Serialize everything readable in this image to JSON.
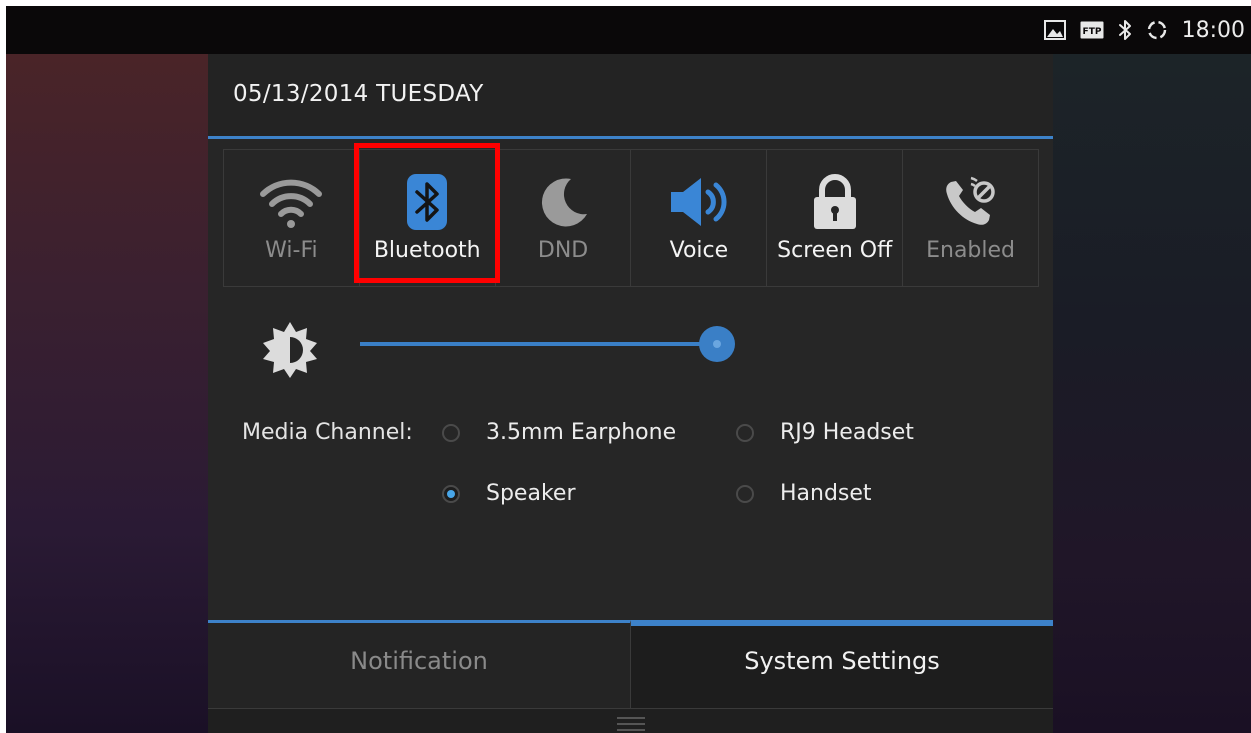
{
  "status_bar": {
    "icons": [
      "image-icon",
      "ftp-icon",
      "bluetooth-icon",
      "sync-icon"
    ],
    "ftp_label": "FTP",
    "time": "18:00"
  },
  "panel": {
    "date": "05/13/2014 TUESDAY",
    "toggles": [
      {
        "label": "Wi-Fi",
        "icon": "wifi-icon",
        "state": "off"
      },
      {
        "label": "Bluetooth",
        "icon": "bluetooth-icon",
        "state": "on",
        "highlighted": true
      },
      {
        "label": "DND",
        "icon": "moon-icon",
        "state": "off"
      },
      {
        "label": "Voice",
        "icon": "speaker-icon",
        "state": "on"
      },
      {
        "label": "Screen Off",
        "icon": "lock-icon",
        "state": "on"
      },
      {
        "label": "Enabled",
        "icon": "call-block-icon",
        "state": "off"
      }
    ],
    "brightness": {
      "icon": "brightness-icon",
      "level": 0.92
    },
    "media_channel": {
      "label": "Media Channel:",
      "options": [
        {
          "label": "3.5mm Earphone",
          "selected": false
        },
        {
          "label": "RJ9 Headset",
          "selected": false
        },
        {
          "label": "Speaker",
          "selected": true
        },
        {
          "label": "Handset",
          "selected": false
        }
      ]
    },
    "tabs": [
      {
        "label": "Notification",
        "active": false
      },
      {
        "label": "System Settings",
        "active": true
      }
    ]
  },
  "colors": {
    "accent": "#3d82c9",
    "active_icon": "#3a86d6",
    "highlight_box": "#ff0000",
    "panel_bg": "#262626"
  }
}
